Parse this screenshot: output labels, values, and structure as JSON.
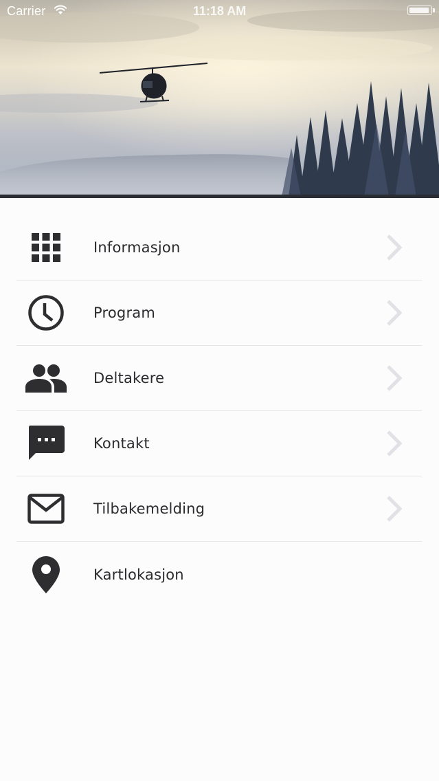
{
  "status_bar": {
    "carrier": "Carrier",
    "time": "11:18 AM",
    "battery_level": 0.95
  },
  "hero": {
    "image": "helicopter-over-misty-forest"
  },
  "colors": {
    "icon": "#2e2e31",
    "label": "#2b2b2e",
    "chevron": "#e2e2e6",
    "divider": "#e6e6e8",
    "background": "#fcfcfd"
  },
  "menu": {
    "items": [
      {
        "label": "Informasjon",
        "icon": "grid-icon",
        "has_chevron": true
      },
      {
        "label": "Program",
        "icon": "clock-icon",
        "has_chevron": true
      },
      {
        "label": "Deltakere",
        "icon": "people-icon",
        "has_chevron": true
      },
      {
        "label": "Kontakt",
        "icon": "chat-bubble-icon",
        "has_chevron": true
      },
      {
        "label": "Tilbakemelding",
        "icon": "envelope-icon",
        "has_chevron": true
      },
      {
        "label": "Kartlokasjon",
        "icon": "map-pin-icon",
        "has_chevron": false
      }
    ]
  }
}
